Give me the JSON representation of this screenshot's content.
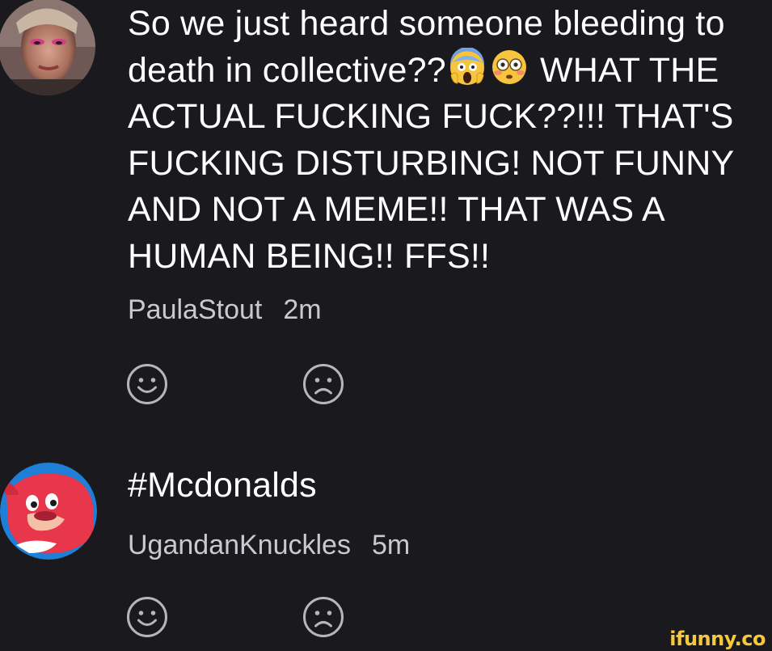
{
  "comments": [
    {
      "author": "PaulaStout",
      "time": "2m",
      "text_part1": "So we just heard someone bleeding to death in collective??",
      "text_part2": " WHAT THE ACTUAL FUCKING FUCK??!!! THAT'S FUCKING DISTURBING! NOT FUNNY AND NOT A MEME!! THAT WAS A HUMAN BEING!! FFS!!",
      "emojis": [
        "screaming-face-icon",
        "flushed-face-icon"
      ],
      "avatar": "profile-photo-woman-pink-eyeshadow",
      "reactions": [
        "smile-icon",
        "frown-icon"
      ]
    },
    {
      "author": "UgandanKnuckles",
      "time": "5m",
      "text": "#Mcdonalds",
      "avatar": "ugandan-knuckles-avatar",
      "reactions": [
        "smile-icon",
        "frown-icon"
      ]
    }
  ],
  "colors": {
    "background": "#19191e",
    "text": "#ffffff",
    "meta_text": "#c9c9cf",
    "icon_gray": "#b5b5bb",
    "watermark": "#f6c83b"
  },
  "watermark": "ifunny.co"
}
